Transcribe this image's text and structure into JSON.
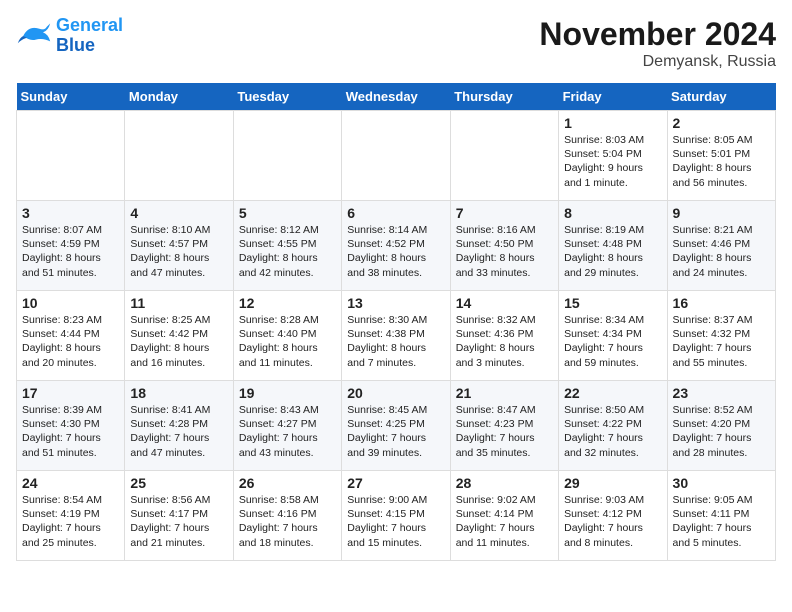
{
  "logo": {
    "line1": "General",
    "line2": "Blue"
  },
  "title": "November 2024",
  "location": "Demyansk, Russia",
  "days_of_week": [
    "Sunday",
    "Monday",
    "Tuesday",
    "Wednesday",
    "Thursday",
    "Friday",
    "Saturday"
  ],
  "weeks": [
    [
      {
        "day": "",
        "info": ""
      },
      {
        "day": "",
        "info": ""
      },
      {
        "day": "",
        "info": ""
      },
      {
        "day": "",
        "info": ""
      },
      {
        "day": "",
        "info": ""
      },
      {
        "day": "1",
        "info": "Sunrise: 8:03 AM\nSunset: 5:04 PM\nDaylight: 9 hours\nand 1 minute."
      },
      {
        "day": "2",
        "info": "Sunrise: 8:05 AM\nSunset: 5:01 PM\nDaylight: 8 hours\nand 56 minutes."
      }
    ],
    [
      {
        "day": "3",
        "info": "Sunrise: 8:07 AM\nSunset: 4:59 PM\nDaylight: 8 hours\nand 51 minutes."
      },
      {
        "day": "4",
        "info": "Sunrise: 8:10 AM\nSunset: 4:57 PM\nDaylight: 8 hours\nand 47 minutes."
      },
      {
        "day": "5",
        "info": "Sunrise: 8:12 AM\nSunset: 4:55 PM\nDaylight: 8 hours\nand 42 minutes."
      },
      {
        "day": "6",
        "info": "Sunrise: 8:14 AM\nSunset: 4:52 PM\nDaylight: 8 hours\nand 38 minutes."
      },
      {
        "day": "7",
        "info": "Sunrise: 8:16 AM\nSunset: 4:50 PM\nDaylight: 8 hours\nand 33 minutes."
      },
      {
        "day": "8",
        "info": "Sunrise: 8:19 AM\nSunset: 4:48 PM\nDaylight: 8 hours\nand 29 minutes."
      },
      {
        "day": "9",
        "info": "Sunrise: 8:21 AM\nSunset: 4:46 PM\nDaylight: 8 hours\nand 24 minutes."
      }
    ],
    [
      {
        "day": "10",
        "info": "Sunrise: 8:23 AM\nSunset: 4:44 PM\nDaylight: 8 hours\nand 20 minutes."
      },
      {
        "day": "11",
        "info": "Sunrise: 8:25 AM\nSunset: 4:42 PM\nDaylight: 8 hours\nand 16 minutes."
      },
      {
        "day": "12",
        "info": "Sunrise: 8:28 AM\nSunset: 4:40 PM\nDaylight: 8 hours\nand 11 minutes."
      },
      {
        "day": "13",
        "info": "Sunrise: 8:30 AM\nSunset: 4:38 PM\nDaylight: 8 hours\nand 7 minutes."
      },
      {
        "day": "14",
        "info": "Sunrise: 8:32 AM\nSunset: 4:36 PM\nDaylight: 8 hours\nand 3 minutes."
      },
      {
        "day": "15",
        "info": "Sunrise: 8:34 AM\nSunset: 4:34 PM\nDaylight: 7 hours\nand 59 minutes."
      },
      {
        "day": "16",
        "info": "Sunrise: 8:37 AM\nSunset: 4:32 PM\nDaylight: 7 hours\nand 55 minutes."
      }
    ],
    [
      {
        "day": "17",
        "info": "Sunrise: 8:39 AM\nSunset: 4:30 PM\nDaylight: 7 hours\nand 51 minutes."
      },
      {
        "day": "18",
        "info": "Sunrise: 8:41 AM\nSunset: 4:28 PM\nDaylight: 7 hours\nand 47 minutes."
      },
      {
        "day": "19",
        "info": "Sunrise: 8:43 AM\nSunset: 4:27 PM\nDaylight: 7 hours\nand 43 minutes."
      },
      {
        "day": "20",
        "info": "Sunrise: 8:45 AM\nSunset: 4:25 PM\nDaylight: 7 hours\nand 39 minutes."
      },
      {
        "day": "21",
        "info": "Sunrise: 8:47 AM\nSunset: 4:23 PM\nDaylight: 7 hours\nand 35 minutes."
      },
      {
        "day": "22",
        "info": "Sunrise: 8:50 AM\nSunset: 4:22 PM\nDaylight: 7 hours\nand 32 minutes."
      },
      {
        "day": "23",
        "info": "Sunrise: 8:52 AM\nSunset: 4:20 PM\nDaylight: 7 hours\nand 28 minutes."
      }
    ],
    [
      {
        "day": "24",
        "info": "Sunrise: 8:54 AM\nSunset: 4:19 PM\nDaylight: 7 hours\nand 25 minutes."
      },
      {
        "day": "25",
        "info": "Sunrise: 8:56 AM\nSunset: 4:17 PM\nDaylight: 7 hours\nand 21 minutes."
      },
      {
        "day": "26",
        "info": "Sunrise: 8:58 AM\nSunset: 4:16 PM\nDaylight: 7 hours\nand 18 minutes."
      },
      {
        "day": "27",
        "info": "Sunrise: 9:00 AM\nSunset: 4:15 PM\nDaylight: 7 hours\nand 15 minutes."
      },
      {
        "day": "28",
        "info": "Sunrise: 9:02 AM\nSunset: 4:14 PM\nDaylight: 7 hours\nand 11 minutes."
      },
      {
        "day": "29",
        "info": "Sunrise: 9:03 AM\nSunset: 4:12 PM\nDaylight: 7 hours\nand 8 minutes."
      },
      {
        "day": "30",
        "info": "Sunrise: 9:05 AM\nSunset: 4:11 PM\nDaylight: 7 hours\nand 5 minutes."
      }
    ]
  ]
}
